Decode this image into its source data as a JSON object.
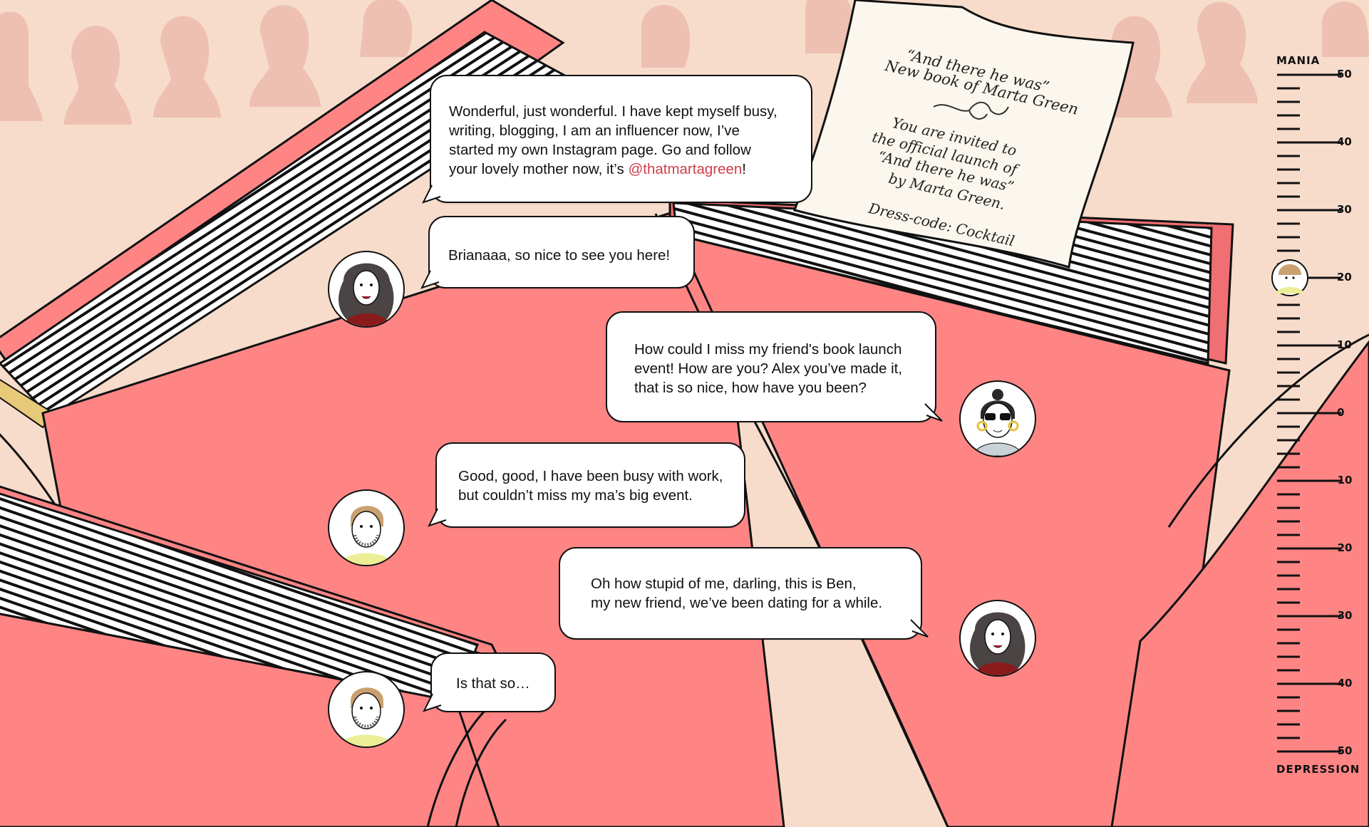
{
  "colors": {
    "background": "#f7dccb",
    "crowd": "#eec0b2",
    "book_cover": "#ff8585",
    "book_cover_dark": "#f06f72",
    "link": "#cf3d4a"
  },
  "invitation": {
    "lines": [
      "“And there he was”",
      "New book of Marta Green",
      "You are invited to",
      "the official launch of",
      "“And there he was”",
      "by Marta Green.",
      "Dress-code: Cocktail"
    ]
  },
  "chat": [
    {
      "id": "m1",
      "speaker": "marta",
      "text_before": "Wonderful, just wonderful. I have kept myself busy,\nwriting, blogging, I am an influencer now, I’ve\nstarted my own Instagram page. Go and follow\nyour lovely mother now, it’s ",
      "link": "@thatmartagreen",
      "text_after": "!"
    },
    {
      "id": "m2",
      "speaker": "marta",
      "text": "Brianaaa, so nice to see you here!"
    },
    {
      "id": "m3",
      "speaker": "briana",
      "text": "How could I miss my friend's book launch\nevent! How are you? Alex you’ve made it,\nthat is so nice, how have you been?"
    },
    {
      "id": "m4",
      "speaker": "alex",
      "text": "Good, good, I have been busy with work,\nbut couldn’t miss my ma’s big event."
    },
    {
      "id": "m5",
      "speaker": "marta",
      "text": "Oh how stupid of me, darling, this is Ben,\nmy new friend, we’ve been dating for a while."
    },
    {
      "id": "m6",
      "speaker": "alex",
      "text": "Is that so…"
    }
  ],
  "mood_scale": {
    "top_label": "MANIA",
    "bottom_label": "DEPRESSION",
    "tick_labels": [
      "50",
      "40",
      "30",
      "20",
      "10",
      "0",
      "−10",
      "−20",
      "−30",
      "−40",
      "−50"
    ],
    "marker_value": 20,
    "marker_icon": "alex-face-icon"
  }
}
